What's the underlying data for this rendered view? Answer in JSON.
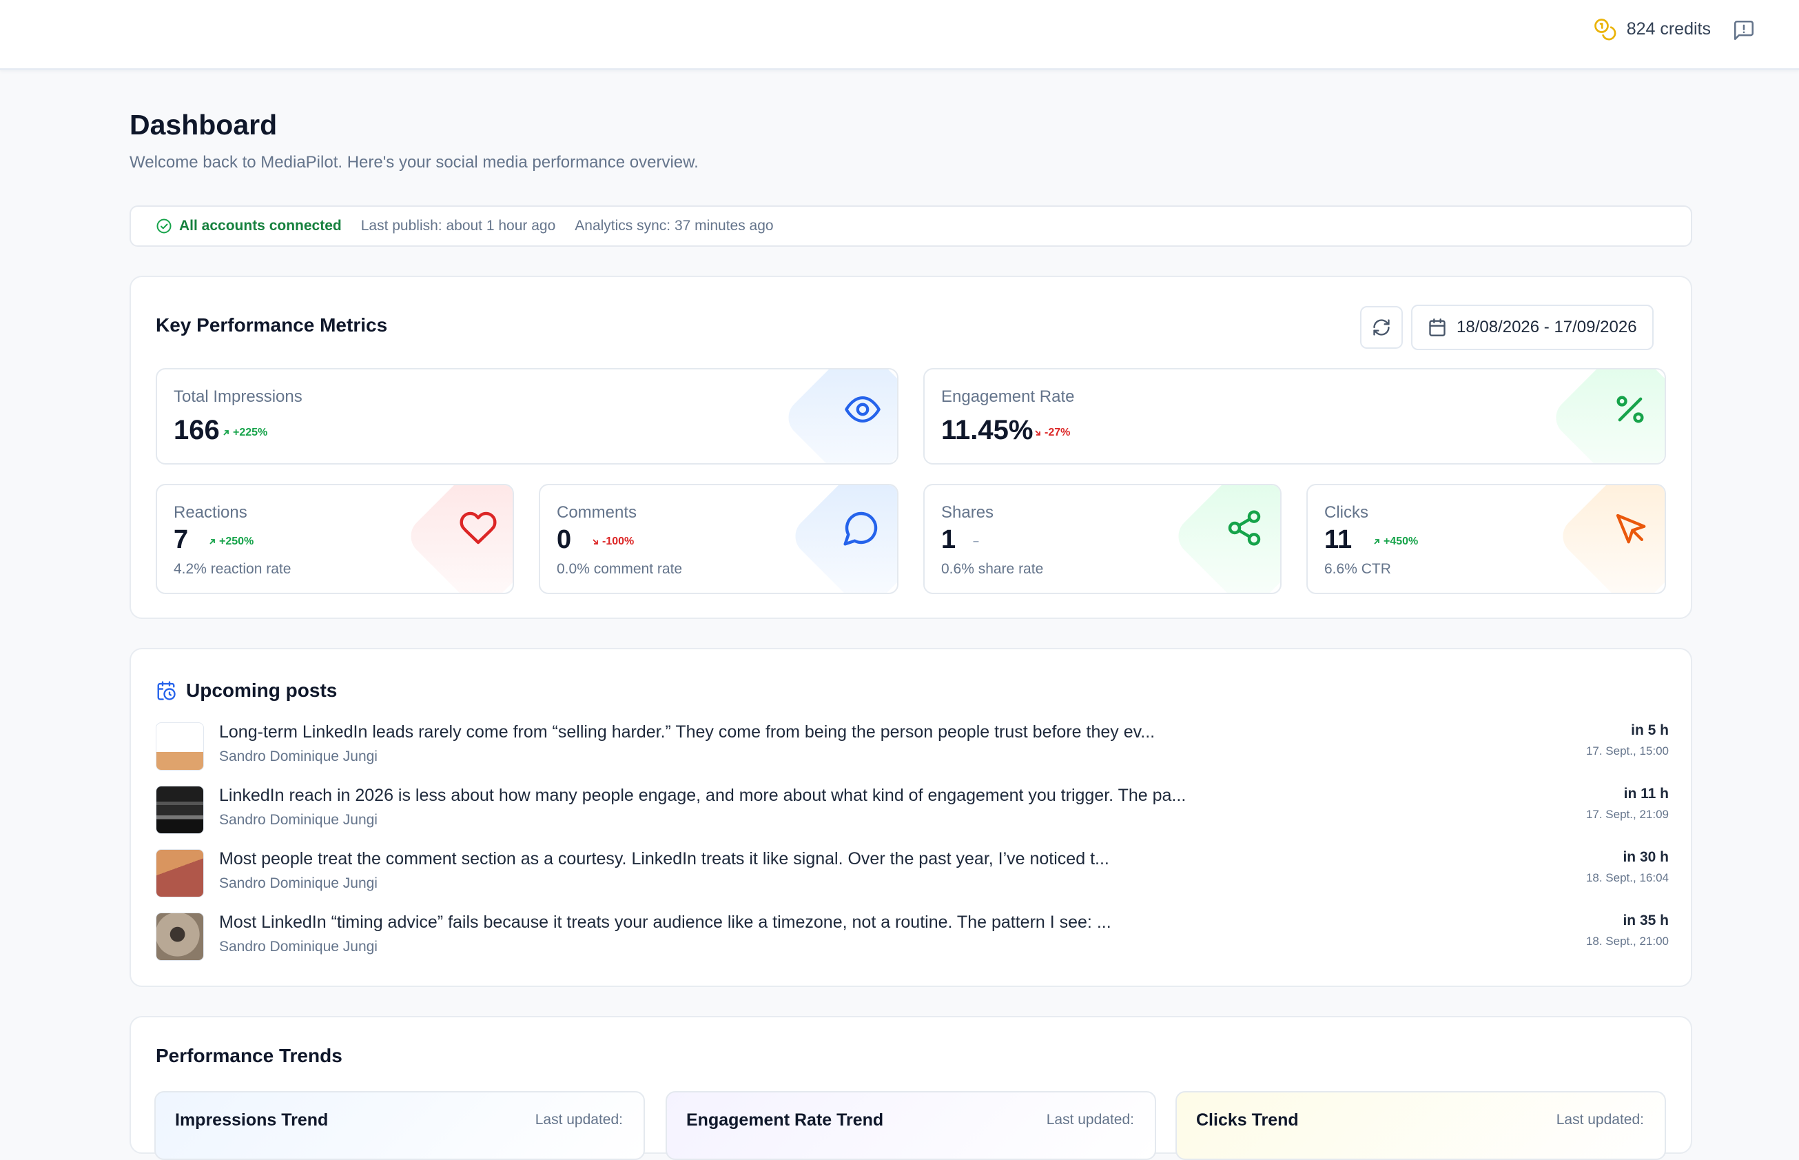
{
  "topbar": {
    "credits_label": "824 credits"
  },
  "header": {
    "title": "Dashboard",
    "subtitle": "Welcome back to MediaPilot. Here's your social media performance overview."
  },
  "status": {
    "connected": "All accounts connected",
    "last_publish": "Last publish: about 1 hour ago",
    "analytics_sync": "Analytics sync: 37 minutes ago"
  },
  "kpi": {
    "title": "Key Performance Metrics",
    "date_range": "18/08/2026 - 17/09/2026",
    "metrics": {
      "impressions": {
        "label": "Total Impressions",
        "value": "166",
        "delta": "+225%",
        "trend": "up",
        "icon": "eye-icon"
      },
      "engagement": {
        "label": "Engagement Rate",
        "value": "11.45%",
        "delta": "-27%",
        "trend": "down",
        "icon": "percent-icon"
      },
      "reactions": {
        "label": "Reactions",
        "value": "7",
        "delta": "+250%",
        "trend": "up",
        "sub": "4.2% reaction rate",
        "icon": "heart-icon"
      },
      "comments": {
        "label": "Comments",
        "value": "0",
        "delta": "-100%",
        "trend": "down",
        "sub": "0.0% comment rate",
        "icon": "comment-icon"
      },
      "shares": {
        "label": "Shares",
        "value": "1",
        "delta": "–",
        "trend": "flat",
        "sub": "0.6% share rate",
        "icon": "share-icon"
      },
      "clicks": {
        "label": "Clicks",
        "value": "11",
        "delta": "+450%",
        "trend": "up",
        "sub": "6.6% CTR",
        "icon": "cursor-icon"
      }
    },
    "colors": {
      "up": "#16a34a",
      "down": "#dc2626",
      "blue": "#2563eb",
      "green": "#16a34a",
      "red": "#dc2626",
      "orange": "#ea580c"
    }
  },
  "upcoming": {
    "title": "Upcoming posts",
    "posts": [
      {
        "text": "Long-term LinkedIn leads rarely come from “selling harder.” They come from being the person people trust before they ev...",
        "author": "Sandro Dominique Jungi",
        "when": "in 5 h",
        "date": "17. Sept., 15:00"
      },
      {
        "text": "LinkedIn reach in 2026 is less about how many people engage, and more about what kind of engagement you trigger. The pa...",
        "author": "Sandro Dominique Jungi",
        "when": "in 11 h",
        "date": "17. Sept., 21:09"
      },
      {
        "text": "Most people treat the comment section as a courtesy. LinkedIn treats it like signal. Over the past year, I’ve noticed t...",
        "author": "Sandro Dominique Jungi",
        "when": "in 30 h",
        "date": "18. Sept., 16:04"
      },
      {
        "text": "Most LinkedIn “timing advice” fails because it treats your audience like a timezone, not a routine. The pattern I see: ...",
        "author": "Sandro Dominique Jungi",
        "when": "in 35 h",
        "date": "18. Sept., 21:00"
      }
    ]
  },
  "trends": {
    "title": "Performance Trends",
    "cards": [
      {
        "title": "Impressions Trend",
        "updated": "Last updated:"
      },
      {
        "title": "Engagement Rate Trend",
        "updated": "Last updated:"
      },
      {
        "title": "Clicks Trend",
        "updated": "Last updated:"
      }
    ]
  }
}
